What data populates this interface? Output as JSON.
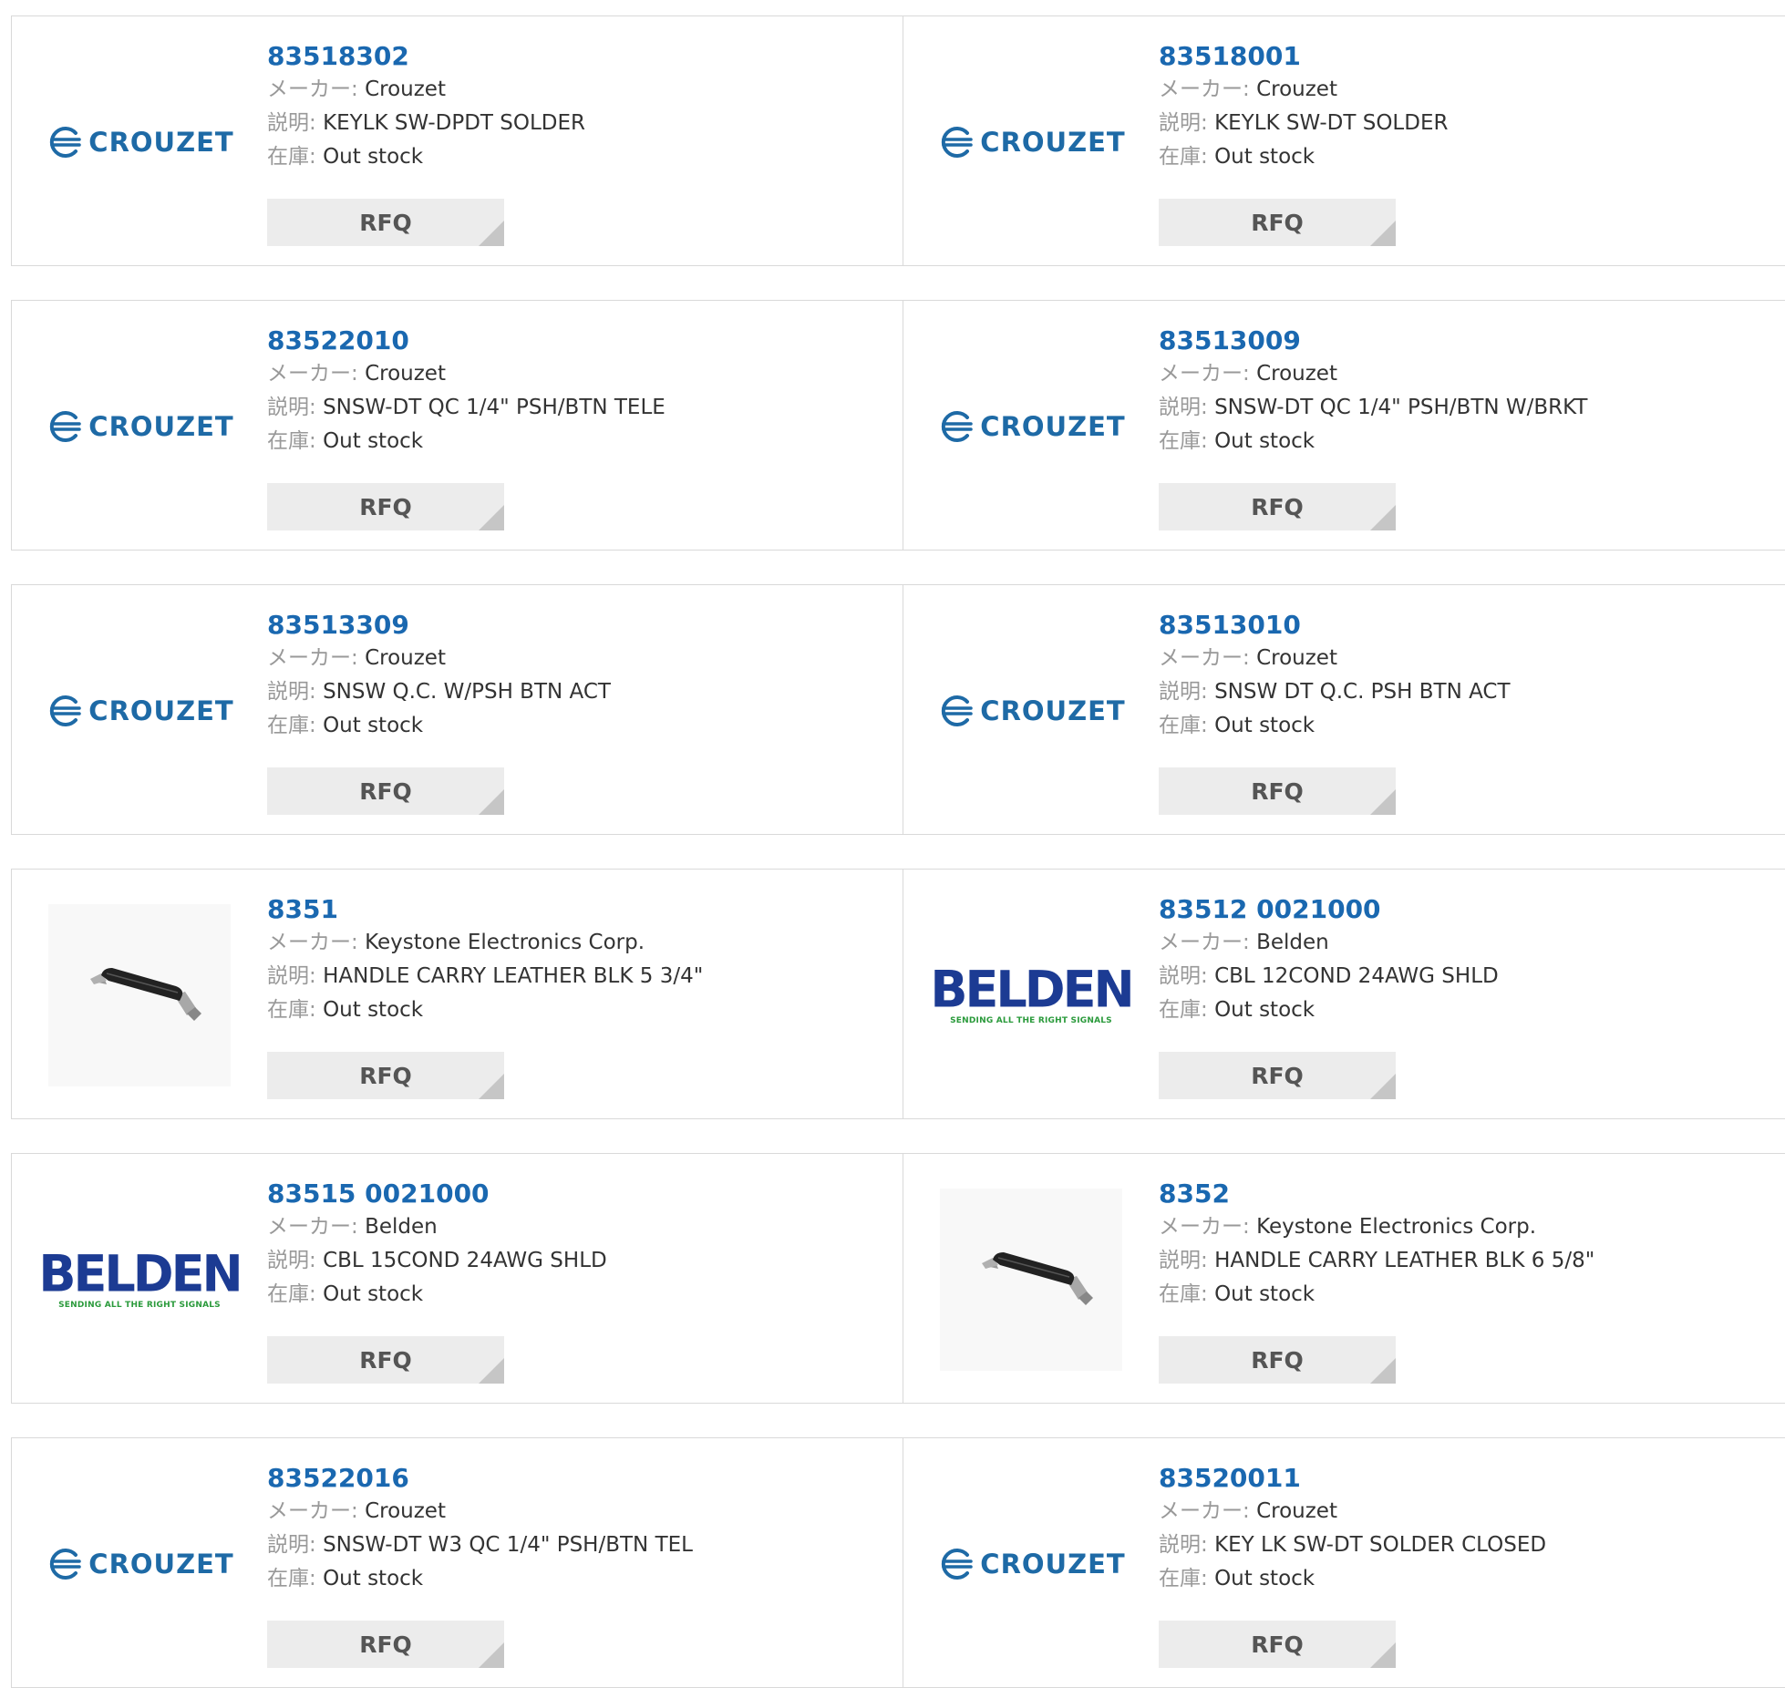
{
  "labels": {
    "maker": "メーカー:",
    "description": "説明:",
    "stock": "在庫:",
    "rfq": "RFQ"
  },
  "logos": {
    "crouzet": "CROUZET",
    "belden": "BELDEN",
    "belden_tagline": "SENDING ALL THE RIGHT SIGNALS"
  },
  "products": [
    {
      "part": "83518302",
      "maker": "Crouzet",
      "description": "KEYLK SW-DPDT SOLDER",
      "stock": "Out stock",
      "logo": "crouzet"
    },
    {
      "part": "83518001",
      "maker": "Crouzet",
      "description": "KEYLK SW-DT SOLDER",
      "stock": "Out stock",
      "logo": "crouzet"
    },
    {
      "part": "83522010",
      "maker": "Crouzet",
      "description": "SNSW-DT QC 1/4\" PSH/BTN TELE",
      "stock": "Out stock",
      "logo": "crouzet"
    },
    {
      "part": "83513009",
      "maker": "Crouzet",
      "description": "SNSW-DT QC 1/4\" PSH/BTN W/BRKT",
      "stock": "Out stock",
      "logo": "crouzet"
    },
    {
      "part": "83513309",
      "maker": "Crouzet",
      "description": "SNSW Q.C. W/PSH BTN ACT",
      "stock": "Out stock",
      "logo": "crouzet"
    },
    {
      "part": "83513010",
      "maker": "Crouzet",
      "description": "SNSW DT Q.C. PSH BTN ACT",
      "stock": "Out stock",
      "logo": "crouzet"
    },
    {
      "part": "8351",
      "maker": "Keystone Electronics Corp.",
      "description": "HANDLE CARRY LEATHER BLK 5 3/4\"",
      "stock": "Out stock",
      "logo": "handle"
    },
    {
      "part": "83512 0021000",
      "maker": "Belden",
      "description": "CBL 12COND 24AWG SHLD",
      "stock": "Out stock",
      "logo": "belden"
    },
    {
      "part": "83515 0021000",
      "maker": "Belden",
      "description": "CBL 15COND 24AWG SHLD",
      "stock": "Out stock",
      "logo": "belden"
    },
    {
      "part": "8352",
      "maker": "Keystone Electronics Corp.",
      "description": "HANDLE CARRY LEATHER BLK 6 5/8\"",
      "stock": "Out stock",
      "logo": "handle"
    },
    {
      "part": "83522016",
      "maker": "Crouzet",
      "description": "SNSW-DT W3 QC 1/4\" PSH/BTN TEL",
      "stock": "Out stock",
      "logo": "crouzet"
    },
    {
      "part": "83520011",
      "maker": "Crouzet",
      "description": "KEY LK SW-DT SOLDER CLOSED",
      "stock": "Out stock",
      "logo": "crouzet"
    }
  ],
  "colors": {
    "part_link": "#1a68b0",
    "crouzet_blue": "#1e6aa6",
    "belden_blue": "#1c3b93",
    "belden_green": "#2a9a3b",
    "rfq_bg": "#ececec"
  }
}
